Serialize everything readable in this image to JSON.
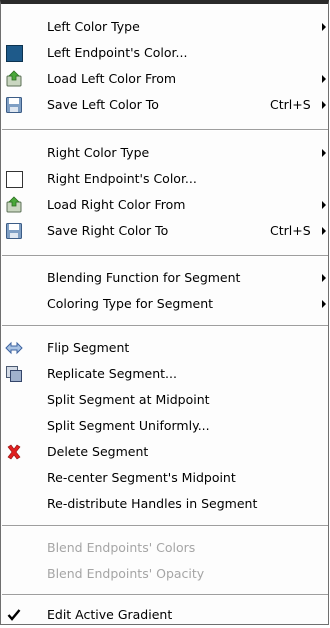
{
  "menu": {
    "items": [
      {
        "label": "Left Color Type",
        "submenu": true
      },
      {
        "label": "Left Endpoint's Color...",
        "icon": "color-swatch-icon",
        "swatch": "#1e5a8a"
      },
      {
        "label": "Load Left Color From",
        "icon": "load-icon",
        "submenu": true
      },
      {
        "label": "Save Left Color To",
        "icon": "save-icon",
        "accel": "Ctrl+S",
        "submenu": true
      },
      {
        "label": "Right Color Type",
        "submenu": true
      },
      {
        "label": "Right Endpoint's Color...",
        "icon": "color-swatch-icon",
        "swatch": "#ffffff"
      },
      {
        "label": "Load Right Color From",
        "icon": "load-icon",
        "submenu": true
      },
      {
        "label": "Save Right Color To",
        "icon": "save-icon",
        "accel": "Ctrl+S",
        "submenu": true
      },
      {
        "label": "Blending Function for Segment",
        "submenu": true
      },
      {
        "label": "Coloring Type for Segment",
        "submenu": true
      },
      {
        "label": "Flip Segment",
        "icon": "flip-icon"
      },
      {
        "label": "Replicate Segment...",
        "icon": "replicate-icon"
      },
      {
        "label": "Split Segment at Midpoint"
      },
      {
        "label": "Split Segment Uniformly..."
      },
      {
        "label": "Delete Segment",
        "icon": "delete-icon"
      },
      {
        "label": "Re-center Segment's Midpoint"
      },
      {
        "label": "Re-distribute Handles in Segment"
      },
      {
        "label": "Blend Endpoints' Colors",
        "disabled": true
      },
      {
        "label": "Blend Endpoints' Opacity",
        "disabled": true
      },
      {
        "label": "Edit Active Gradient",
        "icon": "check-icon",
        "checked": true
      }
    ]
  }
}
